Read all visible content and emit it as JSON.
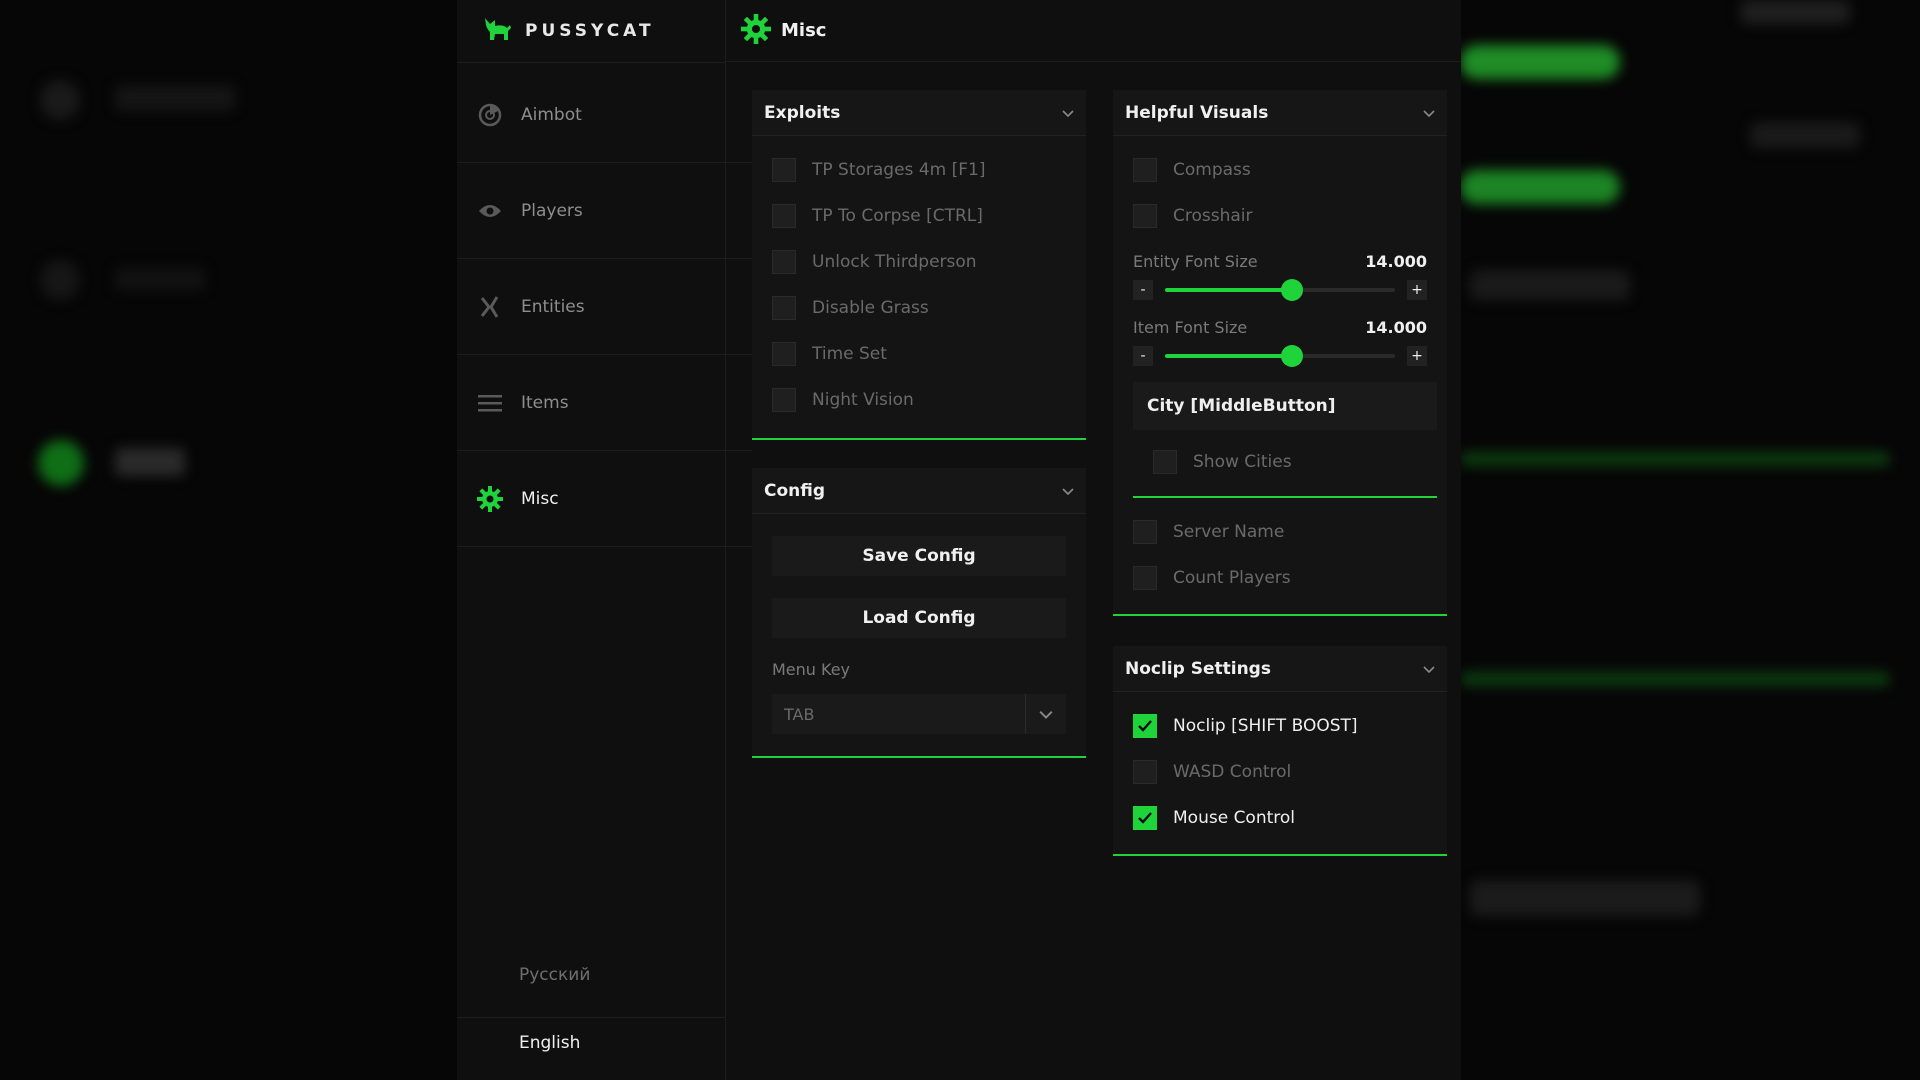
{
  "app": {
    "brand": "PUSSYCAT",
    "accent": "#1fd33a"
  },
  "header": {
    "title": "Misc",
    "icon": "gear-icon"
  },
  "sidebar": {
    "items": [
      {
        "label": "Aimbot",
        "icon": "aimbot-icon",
        "active": false
      },
      {
        "label": "Players",
        "icon": "eye-icon",
        "active": false
      },
      {
        "label": "Entities",
        "icon": "entities-icon",
        "active": false
      },
      {
        "label": "Items",
        "icon": "menu-lines-icon",
        "active": false
      },
      {
        "label": "Misc",
        "icon": "gear-icon",
        "active": true
      }
    ],
    "languages": [
      {
        "label": "Русский",
        "active": false
      },
      {
        "label": "English",
        "active": true
      }
    ]
  },
  "exploits": {
    "title": "Exploits",
    "options": [
      {
        "label": "TP Storages 4m [F1]",
        "checked": false
      },
      {
        "label": "TP To Corpse [CTRL]",
        "checked": false
      },
      {
        "label": "Unlock Thirdperson",
        "checked": false
      },
      {
        "label": "Disable Grass",
        "checked": false
      },
      {
        "label": "Time Set",
        "checked": false
      },
      {
        "label": "Night Vision",
        "checked": false
      }
    ]
  },
  "config": {
    "title": "Config",
    "save_label": "Save Config",
    "load_label": "Load Config",
    "menu_key_label": "Menu Key",
    "menu_key_value": "TAB"
  },
  "helpful_visuals": {
    "title": "Helpful Visuals",
    "compass": {
      "label": "Compass",
      "checked": false
    },
    "crosshair": {
      "label": "Crosshair",
      "checked": false
    },
    "entity_font": {
      "label": "Entity Font Size",
      "value": "14.000",
      "minus": "-",
      "plus": "+",
      "fraction": 0.55
    },
    "item_font": {
      "label": "Item Font Size",
      "value": "14.000",
      "minus": "-",
      "plus": "+",
      "fraction": 0.55
    },
    "city": {
      "title": "City [MiddleButton]",
      "show_cities": {
        "label": "Show Cities",
        "checked": false
      }
    },
    "server_name": {
      "label": "Server Name",
      "checked": false
    },
    "count_players": {
      "label": "Count Players",
      "checked": false
    }
  },
  "noclip": {
    "title": "Noclip Settings",
    "options": [
      {
        "label": "Noclip [SHIFT BOOST]",
        "checked": true
      },
      {
        "label": "WASD Control",
        "checked": false
      },
      {
        "label": "Mouse Control",
        "checked": true
      }
    ]
  }
}
